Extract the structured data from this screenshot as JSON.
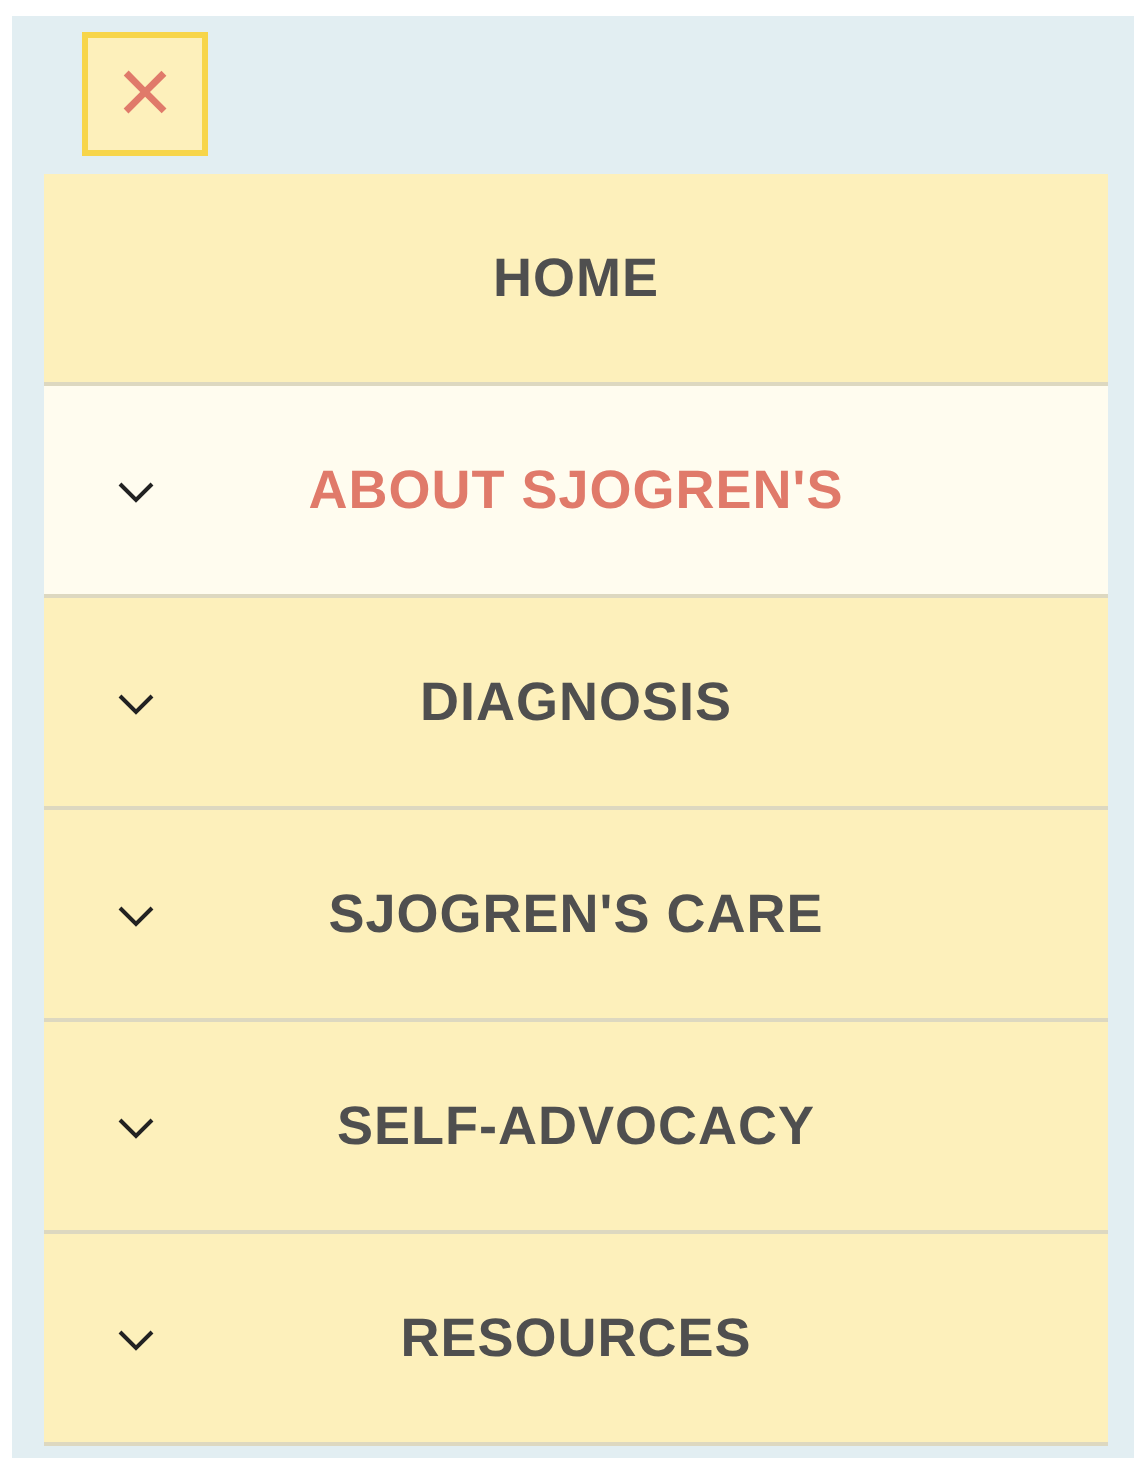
{
  "close_button": {
    "label": "×"
  },
  "menu": [
    {
      "label": "HOME",
      "selected": false,
      "has_submenu": false
    },
    {
      "label": "ABOUT SJOGREN'S",
      "selected": true,
      "has_submenu": true
    },
    {
      "label": "DIAGNOSIS",
      "selected": false,
      "has_submenu": true
    },
    {
      "label": "SJOGREN'S CARE",
      "selected": false,
      "has_submenu": true
    },
    {
      "label": "SELF-ADVOCACY",
      "selected": false,
      "has_submenu": true
    },
    {
      "label": "RESOURCES",
      "selected": false,
      "has_submenu": true
    }
  ]
}
